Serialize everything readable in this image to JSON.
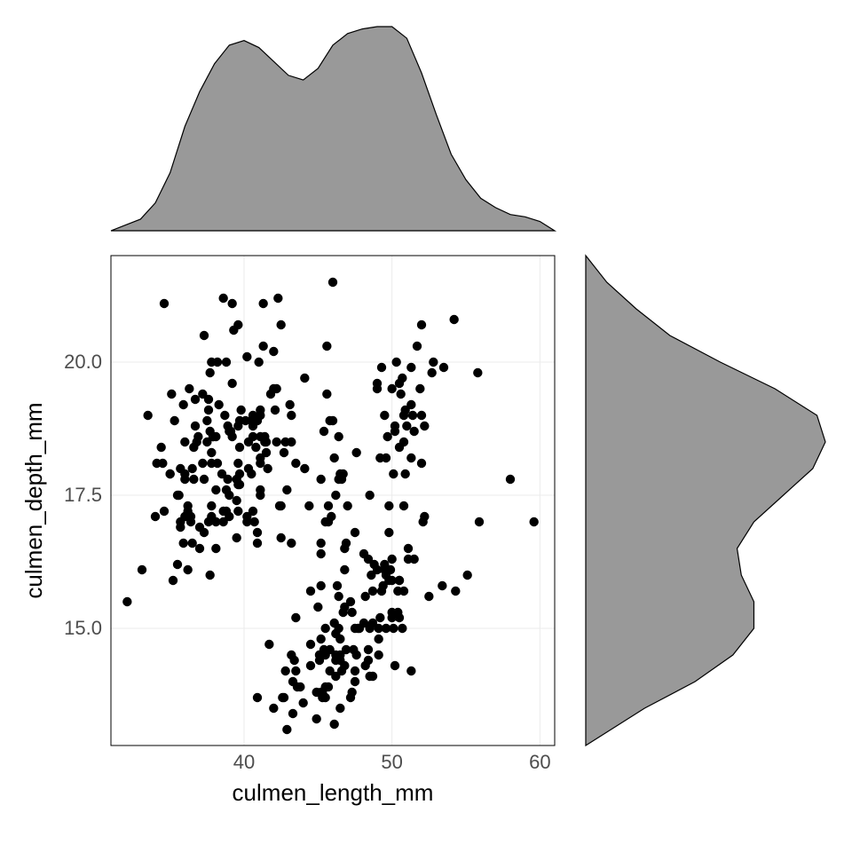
{
  "chart_data": {
    "type": "scatter",
    "title": "",
    "xlabel": "culmen_length_mm",
    "ylabel": "culmen_depth_mm",
    "xlim": [
      31,
      61
    ],
    "ylim": [
      12.8,
      22
    ],
    "x_ticks": [
      40,
      50,
      60
    ],
    "y_ticks": [
      15.0,
      17.5,
      20.0
    ],
    "points": [
      [
        39.1,
        18.7
      ],
      [
        39.5,
        17.4
      ],
      [
        40.3,
        18.0
      ],
      [
        36.7,
        19.3
      ],
      [
        39.3,
        20.6
      ],
      [
        38.9,
        17.8
      ],
      [
        39.2,
        19.6
      ],
      [
        34.1,
        18.1
      ],
      [
        42.0,
        20.2
      ],
      [
        37.8,
        17.1
      ],
      [
        37.8,
        17.3
      ],
      [
        41.1,
        17.6
      ],
      [
        38.6,
        21.2
      ],
      [
        34.6,
        21.1
      ],
      [
        36.6,
        17.8
      ],
      [
        38.7,
        19.0
      ],
      [
        42.5,
        20.7
      ],
      [
        34.4,
        18.4
      ],
      [
        46.0,
        21.5
      ],
      [
        37.8,
        18.3
      ],
      [
        37.7,
        18.7
      ],
      [
        35.9,
        19.2
      ],
      [
        38.2,
        18.1
      ],
      [
        38.8,
        17.2
      ],
      [
        35.3,
        18.9
      ],
      [
        40.6,
        18.6
      ],
      [
        40.5,
        17.9
      ],
      [
        37.9,
        18.6
      ],
      [
        40.5,
        18.9
      ],
      [
        39.5,
        16.7
      ],
      [
        37.2,
        18.1
      ],
      [
        39.5,
        17.8
      ],
      [
        40.9,
        18.9
      ],
      [
        36.4,
        17.0
      ],
      [
        39.2,
        21.1
      ],
      [
        38.8,
        20.0
      ],
      [
        42.2,
        18.5
      ],
      [
        37.6,
        19.3
      ],
      [
        39.8,
        19.1
      ],
      [
        36.5,
        18.0
      ],
      [
        40.8,
        18.4
      ],
      [
        36.0,
        18.5
      ],
      [
        44.1,
        19.7
      ],
      [
        37.0,
        16.9
      ],
      [
        39.6,
        18.8
      ],
      [
        41.1,
        19.0
      ],
      [
        37.5,
        18.9
      ],
      [
        36.0,
        17.9
      ],
      [
        42.3,
        21.2
      ],
      [
        39.6,
        17.7
      ],
      [
        40.1,
        18.9
      ],
      [
        35.0,
        17.9
      ],
      [
        42.0,
        19.5
      ],
      [
        34.5,
        18.1
      ],
      [
        41.4,
        18.6
      ],
      [
        39.0,
        17.5
      ],
      [
        40.6,
        18.8
      ],
      [
        36.5,
        16.6
      ],
      [
        37.6,
        19.1
      ],
      [
        35.7,
        16.9
      ],
      [
        41.3,
        21.1
      ],
      [
        37.6,
        17.0
      ],
      [
        41.1,
        18.2
      ],
      [
        36.4,
        17.1
      ],
      [
        41.6,
        18.0
      ],
      [
        35.5,
        16.2
      ],
      [
        41.1,
        19.1
      ],
      [
        35.9,
        16.6
      ],
      [
        41.8,
        19.4
      ],
      [
        33.5,
        19.0
      ],
      [
        39.7,
        18.4
      ],
      [
        39.6,
        17.2
      ],
      [
        45.8,
        18.9
      ],
      [
        35.5,
        17.5
      ],
      [
        42.8,
        18.5
      ],
      [
        40.9,
        16.8
      ],
      [
        37.2,
        19.4
      ],
      [
        36.2,
        16.1
      ],
      [
        42.1,
        19.1
      ],
      [
        34.6,
        17.2
      ],
      [
        42.9,
        17.6
      ],
      [
        36.7,
        18.8
      ],
      [
        35.1,
        19.4
      ],
      [
        37.3,
        17.8
      ],
      [
        41.3,
        20.3
      ],
      [
        36.3,
        19.5
      ],
      [
        36.9,
        18.6
      ],
      [
        38.3,
        19.2
      ],
      [
        38.9,
        18.8
      ],
      [
        35.7,
        18.0
      ],
      [
        41.1,
        18.1
      ],
      [
        34.0,
        17.1
      ],
      [
        39.6,
        18.1
      ],
      [
        36.2,
        17.3
      ],
      [
        40.8,
        18.9
      ],
      [
        38.1,
        18.6
      ],
      [
        40.3,
        18.5
      ],
      [
        33.1,
        16.1
      ],
      [
        43.2,
        18.5
      ],
      [
        35.0,
        17.9
      ],
      [
        41.0,
        20.0
      ],
      [
        37.7,
        16.0
      ],
      [
        37.8,
        20.0
      ],
      [
        37.9,
        18.6
      ],
      [
        39.7,
        18.9
      ],
      [
        38.6,
        17.2
      ],
      [
        38.2,
        20.0
      ],
      [
        38.1,
        17.0
      ],
      [
        43.2,
        19.0
      ],
      [
        38.1,
        16.5
      ],
      [
        45.6,
        20.3
      ],
      [
        39.7,
        17.7
      ],
      [
        42.2,
        19.5
      ],
      [
        39.6,
        20.7
      ],
      [
        42.7,
        18.3
      ],
      [
        38.6,
        17.0
      ],
      [
        37.3,
        20.5
      ],
      [
        35.7,
        17.0
      ],
      [
        41.1,
        18.6
      ],
      [
        36.2,
        17.2
      ],
      [
        37.7,
        19.8
      ],
      [
        40.2,
        17.0
      ],
      [
        41.4,
        18.5
      ],
      [
        35.2,
        15.9
      ],
      [
        40.6,
        19.0
      ],
      [
        38.8,
        17.6
      ],
      [
        41.5,
        18.3
      ],
      [
        39.0,
        17.1
      ],
      [
        44.1,
        18.0
      ],
      [
        38.5,
        17.9
      ],
      [
        43.1,
        19.2
      ],
      [
        36.8,
        18.5
      ],
      [
        37.5,
        18.5
      ],
      [
        38.1,
        17.6
      ],
      [
        41.1,
        17.5
      ],
      [
        35.6,
        17.5
      ],
      [
        40.2,
        20.1
      ],
      [
        37.0,
        16.5
      ],
      [
        39.7,
        17.9
      ],
      [
        40.2,
        17.1
      ],
      [
        40.6,
        17.2
      ],
      [
        32.1,
        15.5
      ],
      [
        40.7,
        17.0
      ],
      [
        37.3,
        16.8
      ],
      [
        39.0,
        18.7
      ],
      [
        39.2,
        18.6
      ],
      [
        36.6,
        18.4
      ],
      [
        36.0,
        17.8
      ],
      [
        37.8,
        18.1
      ],
      [
        36.0,
        17.1
      ],
      [
        41.5,
        18.5
      ],
      [
        46.5,
        17.9
      ],
      [
        50.0,
        19.5
      ],
      [
        51.3,
        19.2
      ],
      [
        45.4,
        18.7
      ],
      [
        52.7,
        19.8
      ],
      [
        45.2,
        17.8
      ],
      [
        46.1,
        18.2
      ],
      [
        51.3,
        18.2
      ],
      [
        46.0,
        18.9
      ],
      [
        51.3,
        19.9
      ],
      [
        46.6,
        17.8
      ],
      [
        51.7,
        20.3
      ],
      [
        47.0,
        17.3
      ],
      [
        52.0,
        18.1
      ],
      [
        45.9,
        17.1
      ],
      [
        50.5,
        19.6
      ],
      [
        50.3,
        20.0
      ],
      [
        58.0,
        17.8
      ],
      [
        46.4,
        18.6
      ],
      [
        49.2,
        18.2
      ],
      [
        42.4,
        17.3
      ],
      [
        48.5,
        17.5
      ],
      [
        43.2,
        16.6
      ],
      [
        50.6,
        19.4
      ],
      [
        46.7,
        17.9
      ],
      [
        52.0,
        19.0
      ],
      [
        50.5,
        18.4
      ],
      [
        49.5,
        19.0
      ],
      [
        46.4,
        17.8
      ],
      [
        52.8,
        20.0
      ],
      [
        40.9,
        16.6
      ],
      [
        54.2,
        20.8
      ],
      [
        42.5,
        16.7
      ],
      [
        51.0,
        18.8
      ],
      [
        49.7,
        18.6
      ],
      [
        47.5,
        16.8
      ],
      [
        47.6,
        18.3
      ],
      [
        52.0,
        20.7
      ],
      [
        46.9,
        16.6
      ],
      [
        53.5,
        19.9
      ],
      [
        49.0,
        19.5
      ],
      [
        46.2,
        17.5
      ],
      [
        50.9,
        19.1
      ],
      [
        45.5,
        17.0
      ],
      [
        50.9,
        17.9
      ],
      [
        50.8,
        18.5
      ],
      [
        50.1,
        17.9
      ],
      [
        49.0,
        19.6
      ],
      [
        51.5,
        18.7
      ],
      [
        49.8,
        17.3
      ],
      [
        48.1,
        16.4
      ],
      [
        51.4,
        19.0
      ],
      [
        45.7,
        17.3
      ],
      [
        50.7,
        19.7
      ],
      [
        42.5,
        17.3
      ],
      [
        52.2,
        18.8
      ],
      [
        45.2,
        16.6
      ],
      [
        49.3,
        19.9
      ],
      [
        50.2,
        18.8
      ],
      [
        45.6,
        19.4
      ],
      [
        51.9,
        19.5
      ],
      [
        46.8,
        16.5
      ],
      [
        45.7,
        17.0
      ],
      [
        55.8,
        19.8
      ],
      [
        43.5,
        18.1
      ],
      [
        49.6,
        18.2
      ],
      [
        50.8,
        19.0
      ],
      [
        50.2,
        18.7
      ],
      [
        46.1,
        13.2
      ],
      [
        50.0,
        16.3
      ],
      [
        48.7,
        14.1
      ],
      [
        50.0,
        15.2
      ],
      [
        47.6,
        14.5
      ],
      [
        46.5,
        13.5
      ],
      [
        45.4,
        14.6
      ],
      [
        46.7,
        15.3
      ],
      [
        43.3,
        13.4
      ],
      [
        46.8,
        15.4
      ],
      [
        40.9,
        13.7
      ],
      [
        49.0,
        16.1
      ],
      [
        45.5,
        13.7
      ],
      [
        48.4,
        14.6
      ],
      [
        45.8,
        14.6
      ],
      [
        49.3,
        15.7
      ],
      [
        42.0,
        13.5
      ],
      [
        49.2,
        15.2
      ],
      [
        46.2,
        14.5
      ],
      [
        48.7,
        15.1
      ],
      [
        50.2,
        14.3
      ],
      [
        45.1,
        14.5
      ],
      [
        46.5,
        14.5
      ],
      [
        46.3,
        15.8
      ],
      [
        42.9,
        13.1
      ],
      [
        46.1,
        15.1
      ],
      [
        44.5,
        14.3
      ],
      [
        47.8,
        15.0
      ],
      [
        48.2,
        14.3
      ],
      [
        50.0,
        15.3
      ],
      [
        47.3,
        15.3
      ],
      [
        42.8,
        14.2
      ],
      [
        45.1,
        14.5
      ],
      [
        59.6,
        17.0
      ],
      [
        49.1,
        14.8
      ],
      [
        48.4,
        16.3
      ],
      [
        42.6,
        13.7
      ],
      [
        44.4,
        17.3
      ],
      [
        44.0,
        13.6
      ],
      [
        48.7,
        15.7
      ],
      [
        42.7,
        13.7
      ],
      [
        49.6,
        16.0
      ],
      [
        45.3,
        13.7
      ],
      [
        49.6,
        15.0
      ],
      [
        50.5,
        15.9
      ],
      [
        43.6,
        13.9
      ],
      [
        45.5,
        13.9
      ],
      [
        50.5,
        15.9
      ],
      [
        44.9,
        13.3
      ],
      [
        45.2,
        15.8
      ],
      [
        46.6,
        14.2
      ],
      [
        48.5,
        14.1
      ],
      [
        45.1,
        14.4
      ],
      [
        50.1,
        15.0
      ],
      [
        46.5,
        14.4
      ],
      [
        45.0,
        15.4
      ],
      [
        43.8,
        13.9
      ],
      [
        45.5,
        15.0
      ],
      [
        43.2,
        14.5
      ],
      [
        50.4,
        15.3
      ],
      [
        45.3,
        13.8
      ],
      [
        46.2,
        14.9
      ],
      [
        45.7,
        13.9
      ],
      [
        54.3,
        15.7
      ],
      [
        45.8,
        14.2
      ],
      [
        49.8,
        16.8
      ],
      [
        46.2,
        14.4
      ],
      [
        49.5,
        16.2
      ],
      [
        43.5,
        14.2
      ],
      [
        50.7,
        15.0
      ],
      [
        47.7,
        15.0
      ],
      [
        46.4,
        15.6
      ],
      [
        48.2,
        15.6
      ],
      [
        46.5,
        14.8
      ],
      [
        46.4,
        15.0
      ],
      [
        48.6,
        16.0
      ],
      [
        47.5,
        14.2
      ],
      [
        51.1,
        16.3
      ],
      [
        45.2,
        13.8
      ],
      [
        45.2,
        16.4
      ],
      [
        49.1,
        14.5
      ],
      [
        52.5,
        15.6
      ],
      [
        47.4,
        14.6
      ],
      [
        50.0,
        15.9
      ],
      [
        44.9,
        13.8
      ],
      [
        50.8,
        17.3
      ],
      [
        43.4,
        14.4
      ],
      [
        51.3,
        14.2
      ],
      [
        47.5,
        14.0
      ],
      [
        52.1,
        17.0
      ],
      [
        47.5,
        15.0
      ],
      [
        52.2,
        17.1
      ],
      [
        45.5,
        14.5
      ],
      [
        49.5,
        16.1
      ],
      [
        44.5,
        14.7
      ],
      [
        50.8,
        15.7
      ],
      [
        49.4,
        15.8
      ],
      [
        46.9,
        14.6
      ],
      [
        48.4,
        14.4
      ],
      [
        51.1,
        16.5
      ],
      [
        48.5,
        15.0
      ],
      [
        55.9,
        17.0
      ],
      [
        47.2,
        15.5
      ],
      [
        49.1,
        15.0
      ],
      [
        47.3,
        13.8
      ],
      [
        46.8,
        16.1
      ],
      [
        41.7,
        14.7
      ],
      [
        53.4,
        15.8
      ],
      [
        43.3,
        14.0
      ],
      [
        48.1,
        15.1
      ],
      [
        50.5,
        15.2
      ],
      [
        49.8,
        15.9
      ],
      [
        43.5,
        15.2
      ],
      [
        51.5,
        16.3
      ],
      [
        46.2,
        14.1
      ],
      [
        55.1,
        16.0
      ],
      [
        44.5,
        15.7
      ],
      [
        48.8,
        16.2
      ],
      [
        47.2,
        13.7
      ],
      [
        46.8,
        14.3
      ],
      [
        50.4,
        15.7
      ],
      [
        45.2,
        14.8
      ],
      [
        49.9,
        16.1
      ]
    ],
    "marginal_top": {
      "type": "density",
      "axis": "x",
      "x": [
        31,
        33,
        34,
        35,
        36,
        37,
        38,
        39,
        40,
        41,
        42,
        43,
        44,
        45,
        46,
        47,
        48,
        49,
        50,
        51,
        52,
        53,
        54,
        55,
        56,
        57,
        58,
        59,
        60,
        61
      ],
      "density": [
        0.0,
        0.005,
        0.012,
        0.025,
        0.045,
        0.06,
        0.072,
        0.08,
        0.082,
        0.079,
        0.073,
        0.067,
        0.065,
        0.07,
        0.08,
        0.085,
        0.087,
        0.088,
        0.088,
        0.083,
        0.068,
        0.05,
        0.033,
        0.022,
        0.014,
        0.01,
        0.007,
        0.006,
        0.004,
        0.0
      ]
    },
    "marginal_right": {
      "type": "density",
      "axis": "y",
      "y": [
        12.8,
        13.0,
        13.5,
        14.0,
        14.5,
        15.0,
        15.5,
        16.0,
        16.5,
        17.0,
        17.5,
        18.0,
        18.5,
        19.0,
        19.5,
        20.0,
        20.5,
        21.0,
        21.5,
        22.0
      ],
      "density": [
        0.0,
        0.02,
        0.07,
        0.13,
        0.175,
        0.2,
        0.2,
        0.185,
        0.18,
        0.2,
        0.235,
        0.27,
        0.285,
        0.275,
        0.225,
        0.16,
        0.1,
        0.06,
        0.025,
        0.0
      ]
    }
  },
  "colors": {
    "density_fill": "#999999",
    "grid": "#ebebeb",
    "point": "#000000"
  }
}
